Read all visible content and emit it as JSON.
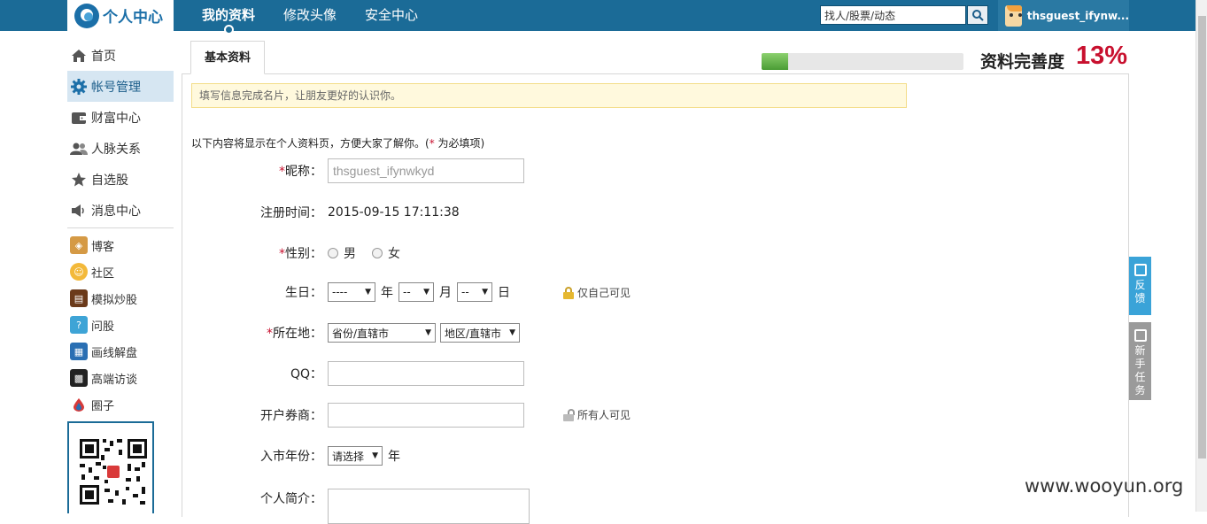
{
  "app": {
    "logo_text": "个人中心"
  },
  "nav": {
    "tabs": [
      "我的资料",
      "修改头像",
      "安全中心"
    ]
  },
  "search": {
    "value": "找人/股票/动态"
  },
  "user": {
    "name": "thsguest_ifynw..."
  },
  "sidebar": {
    "main": [
      "首页",
      "帐号管理",
      "财富中心",
      "人脉关系",
      "自选股",
      "消息中心"
    ],
    "apps": [
      "博客",
      "社区",
      "模拟炒股",
      "问股",
      "画线解盘",
      "高端访谈",
      "圈子"
    ]
  },
  "tab": {
    "label": "基本资料"
  },
  "completeness": {
    "label": "资料完善度",
    "percent_text": "13%",
    "percent": 13
  },
  "notice": "填写信息完成名片，让朋友更好的认识你。",
  "intro": {
    "text": "以下内容将显示在个人资料页，方便大家了解你。(",
    "req": "*",
    "text2": " 为必填项)"
  },
  "form": {
    "nickname": {
      "label": "昵称：",
      "value": "thsguest_ifynwkyd"
    },
    "register": {
      "label": "注册时间：",
      "value": "2015-09-15 17:11:38"
    },
    "gender": {
      "label": "性别：",
      "male": "男",
      "female": "女"
    },
    "birthday": {
      "label": "生日：",
      "year": "----",
      "month": "--",
      "day": "--",
      "u_year": "年",
      "u_month": "月",
      "u_day": "日",
      "privacy": "仅自己可见"
    },
    "location": {
      "label": "所在地：",
      "province": "省份/直辖市",
      "district": "地区/直辖市"
    },
    "qq": {
      "label": "QQ：",
      "value": ""
    },
    "broker": {
      "label": "开户券商：",
      "value": "",
      "privacy": "所有人可见"
    },
    "entry_year": {
      "label": "入市年份：",
      "value": "请选择",
      "unit": "年"
    },
    "bio": {
      "label": "个人简介："
    }
  },
  "float": {
    "feedback": [
      "反",
      "馈"
    ],
    "newbie": [
      "新",
      "手",
      "任",
      "务"
    ]
  },
  "watermark": "www.wooyun.org"
}
